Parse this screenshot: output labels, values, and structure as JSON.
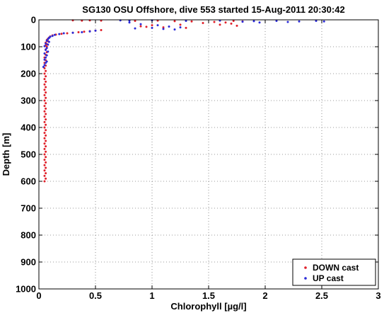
{
  "chart_data": {
    "type": "scatter",
    "title": "SG130 OSU Offshore, dive 553 started 15-Aug-2011 20:30:42",
    "xlabel": "Chlorophyll [µg/l]",
    "ylabel": "Depth [m]",
    "xlim": [
      0,
      3
    ],
    "ylim": [
      0,
      1000
    ],
    "y_reversed": true,
    "grid": true,
    "legend_position": "bottom-right",
    "xticks": [
      0,
      0.5,
      1,
      1.5,
      2,
      2.5,
      3
    ],
    "xtick_labels": [
      "0",
      "0.5",
      "1",
      "1.5",
      "2",
      "2.5",
      "3"
    ],
    "yticks": [
      0,
      100,
      200,
      300,
      400,
      500,
      600,
      700,
      800,
      900,
      1000
    ],
    "ytick_labels": [
      "0",
      "100",
      "200",
      "300",
      "400",
      "500",
      "600",
      "700",
      "800",
      "900",
      "1000"
    ],
    "series": [
      {
        "name": "DOWN cast",
        "color": "#e0202a",
        "points": [
          [
            0.3,
            2
          ],
          [
            0.38,
            3
          ],
          [
            0.45,
            2
          ],
          [
            0.55,
            3
          ],
          [
            0.85,
            4
          ],
          [
            1.05,
            3
          ],
          [
            1.2,
            5
          ],
          [
            1.35,
            6
          ],
          [
            1.55,
            8
          ],
          [
            1.65,
            10
          ],
          [
            1.7,
            14
          ],
          [
            1.72,
            4
          ],
          [
            1.8,
            6
          ],
          [
            1.45,
            12
          ],
          [
            1.25,
            18
          ],
          [
            1.6,
            18
          ],
          [
            1.75,
            22
          ],
          [
            1.0,
            20
          ],
          [
            0.95,
            26
          ],
          [
            1.1,
            28
          ],
          [
            0.9,
            24
          ],
          [
            1.3,
            30
          ],
          [
            0.55,
            38
          ],
          [
            0.5,
            40
          ],
          [
            0.45,
            42
          ],
          [
            0.4,
            44
          ],
          [
            0.35,
            46
          ],
          [
            0.3,
            48
          ],
          [
            0.25,
            50
          ],
          [
            0.2,
            52
          ],
          [
            0.15,
            55
          ],
          [
            0.12,
            58
          ],
          [
            0.1,
            62
          ],
          [
            0.09,
            66
          ],
          [
            0.08,
            70
          ],
          [
            0.07,
            75
          ],
          [
            0.08,
            80
          ],
          [
            0.06,
            85
          ],
          [
            0.07,
            90
          ],
          [
            0.06,
            95
          ],
          [
            0.07,
            100
          ],
          [
            0.06,
            110
          ],
          [
            0.07,
            120
          ],
          [
            0.06,
            130
          ],
          [
            0.05,
            140
          ],
          [
            0.06,
            150
          ],
          [
            0.05,
            160
          ],
          [
            0.06,
            170
          ],
          [
            0.05,
            180
          ],
          [
            0.06,
            190
          ],
          [
            0.05,
            200
          ],
          [
            0.06,
            210
          ],
          [
            0.05,
            220
          ],
          [
            0.06,
            230
          ],
          [
            0.05,
            240
          ],
          [
            0.06,
            250
          ],
          [
            0.05,
            260
          ],
          [
            0.06,
            270
          ],
          [
            0.05,
            280
          ],
          [
            0.06,
            290
          ],
          [
            0.05,
            300
          ],
          [
            0.06,
            310
          ],
          [
            0.05,
            320
          ],
          [
            0.06,
            330
          ],
          [
            0.05,
            340
          ],
          [
            0.06,
            350
          ],
          [
            0.05,
            360
          ],
          [
            0.06,
            370
          ],
          [
            0.05,
            380
          ],
          [
            0.06,
            390
          ],
          [
            0.05,
            400
          ],
          [
            0.06,
            410
          ],
          [
            0.05,
            420
          ],
          [
            0.06,
            430
          ],
          [
            0.05,
            440
          ],
          [
            0.06,
            450
          ],
          [
            0.05,
            460
          ],
          [
            0.06,
            470
          ],
          [
            0.05,
            480
          ],
          [
            0.06,
            490
          ],
          [
            0.05,
            500
          ],
          [
            0.06,
            510
          ],
          [
            0.05,
            520
          ],
          [
            0.06,
            530
          ],
          [
            0.05,
            540
          ],
          [
            0.06,
            550
          ],
          [
            0.05,
            560
          ],
          [
            0.06,
            570
          ],
          [
            0.05,
            580
          ],
          [
            0.06,
            590
          ],
          [
            0.05,
            600
          ]
        ]
      },
      {
        "name": "UP cast",
        "color": "#2a2ad8",
        "points": [
          [
            0.72,
            2
          ],
          [
            0.8,
            3
          ],
          [
            1.0,
            2
          ],
          [
            1.3,
            4
          ],
          [
            1.6,
            3
          ],
          [
            1.9,
            5
          ],
          [
            2.1,
            4
          ],
          [
            2.3,
            6
          ],
          [
            2.45,
            4
          ],
          [
            2.52,
            6
          ],
          [
            2.2,
            8
          ],
          [
            1.95,
            10
          ],
          [
            1.8,
            7
          ],
          [
            0.8,
            10
          ],
          [
            0.9,
            16
          ],
          [
            1.05,
            20
          ],
          [
            1.15,
            25
          ],
          [
            1.25,
            28
          ],
          [
            1.0,
            30
          ],
          [
            0.85,
            32
          ],
          [
            1.1,
            34
          ],
          [
            1.2,
            36
          ],
          [
            0.5,
            40
          ],
          [
            0.45,
            43
          ],
          [
            0.38,
            46
          ],
          [
            0.3,
            48
          ],
          [
            0.22,
            50
          ],
          [
            0.18,
            53
          ],
          [
            0.14,
            56
          ],
          [
            0.12,
            60
          ],
          [
            0.1,
            63
          ],
          [
            0.09,
            67
          ],
          [
            0.08,
            72
          ],
          [
            0.07,
            78
          ],
          [
            0.09,
            82
          ],
          [
            0.06,
            88
          ],
          [
            0.08,
            92
          ],
          [
            0.05,
            98
          ],
          [
            0.07,
            105
          ],
          [
            0.06,
            112
          ],
          [
            0.08,
            118
          ],
          [
            0.05,
            125
          ],
          [
            0.07,
            132
          ],
          [
            0.06,
            140
          ],
          [
            0.05,
            148
          ],
          [
            0.07,
            155
          ],
          [
            0.06,
            160
          ],
          [
            0.05,
            168
          ],
          [
            0.04,
            175
          ]
        ]
      }
    ]
  }
}
